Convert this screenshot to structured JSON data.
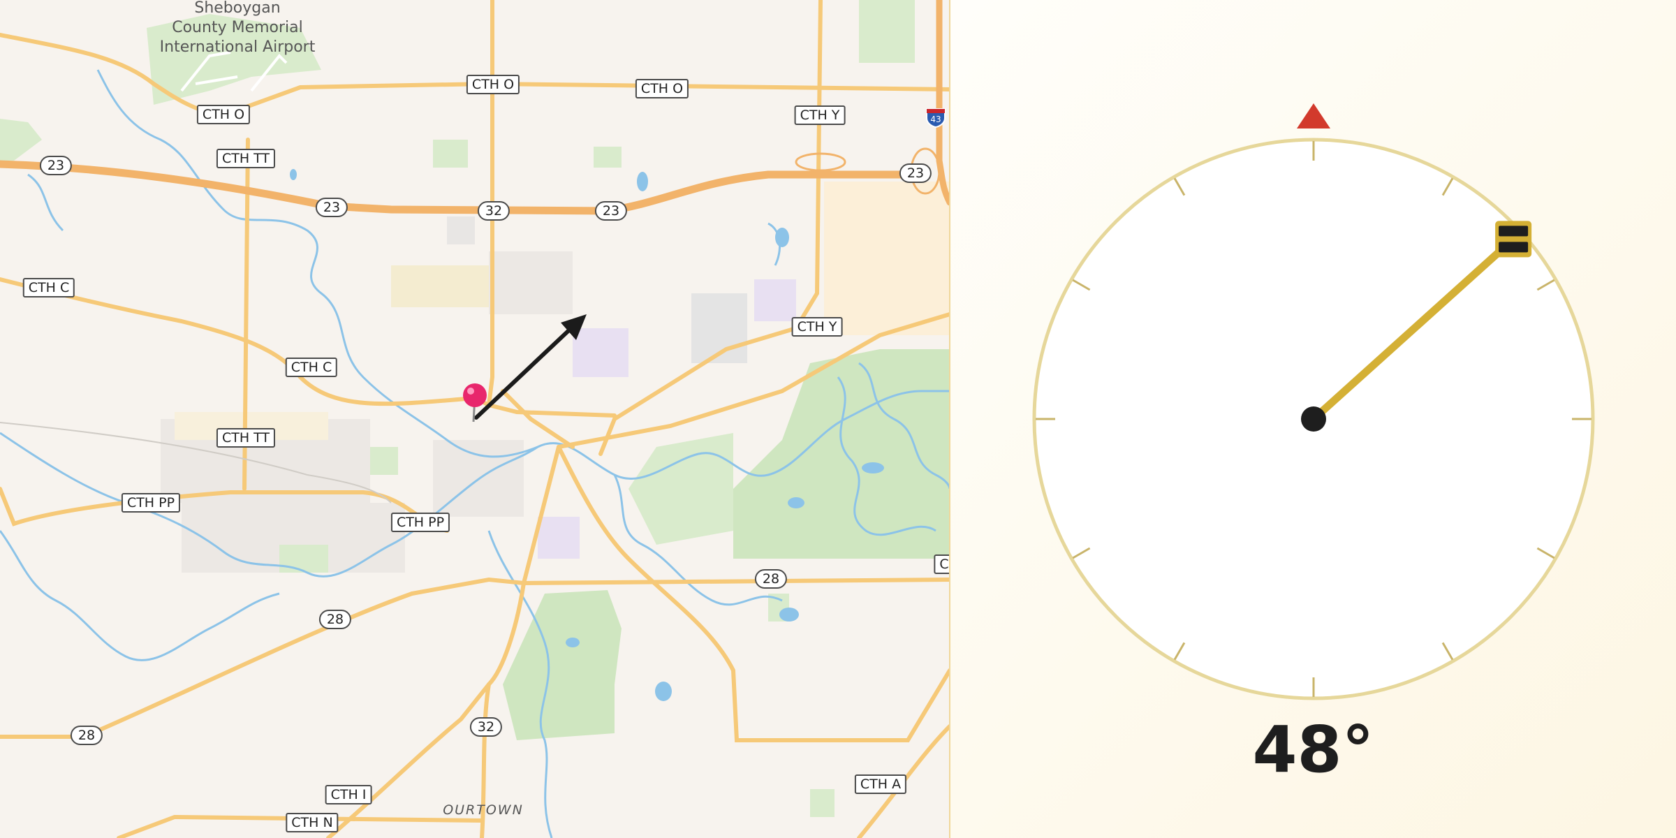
{
  "map": {
    "airport_label_lines": [
      "Sheboygan",
      "County Memorial",
      "International Airport"
    ],
    "district_label": "OURTOWN",
    "route_labels": [
      {
        "text": "CTH O"
      },
      {
        "text": "CTH O"
      },
      {
        "text": "CTH O"
      },
      {
        "text": "CTH Y"
      },
      {
        "text": "CTH TT"
      },
      {
        "text": "23"
      },
      {
        "text": "23"
      },
      {
        "text": "32"
      },
      {
        "text": "23"
      },
      {
        "text": "23"
      },
      {
        "text": "CTH C"
      },
      {
        "text": "CTH Y"
      },
      {
        "text": "CTH C"
      },
      {
        "text": "CTH TT"
      },
      {
        "text": "CTH PP"
      },
      {
        "text": "CTH PP"
      },
      {
        "text": "28"
      },
      {
        "text": "28"
      },
      {
        "text": "28"
      },
      {
        "text": "32"
      },
      {
        "text": "CTH I"
      },
      {
        "text": "CTH A"
      },
      {
        "text": "CTH N"
      },
      {
        "text": "C"
      }
    ],
    "interstate_shield": "43",
    "pin_icon": "map-pin-icon",
    "direction_arrow_icon": "direction-arrow-icon",
    "colors": {
      "land": "#f7f3ee",
      "road": "#f6c978",
      "highway": "#f2b36a",
      "water": "#8cc3e8",
      "park": "#cfe6c0",
      "pin": "#e8266c"
    }
  },
  "compass": {
    "heading_degrees": 48,
    "heading_text": "48°",
    "north_marker_icon": "north-triangle-icon",
    "needle_cap_icon": "needle-cap-icon",
    "colors": {
      "ring": "#e6d79a",
      "tick": "#c9b46a",
      "needle": "#d4b035",
      "north_marker": "#d23a2c",
      "hub": "#1e1e1e"
    }
  }
}
